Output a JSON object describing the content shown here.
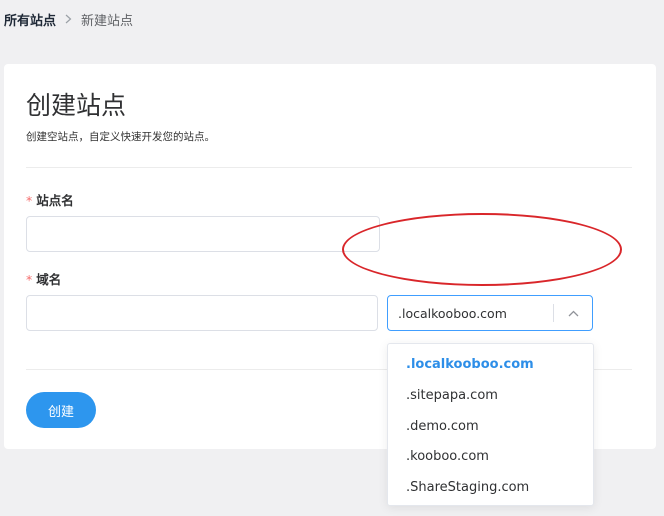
{
  "breadcrumb": {
    "parent": "所有站点",
    "separator": ">",
    "current": "新建站点"
  },
  "form": {
    "title": "创建站点",
    "subtitle": "创建空站点，自定义快速开发您的站点。",
    "required_mark": "*",
    "site_name": {
      "label": "站点名",
      "value": ""
    },
    "domain": {
      "label": "域名",
      "value": "",
      "suffix_selected": ".localkooboo.com",
      "suffix_options": [
        ".localkooboo.com",
        ".sitepapa.com",
        ".demo.com",
        ".kooboo.com",
        ".ShareStaging.com"
      ]
    },
    "create_label": "创建"
  },
  "colors": {
    "primary": "#2d96ee",
    "selected_option": "#2d8ee8",
    "required": "#f56c6c",
    "annotation": "#d9262a"
  },
  "icons": {
    "breadcrumb_separator": "chevron-right-icon",
    "select_arrow": "chevron-up-icon"
  }
}
